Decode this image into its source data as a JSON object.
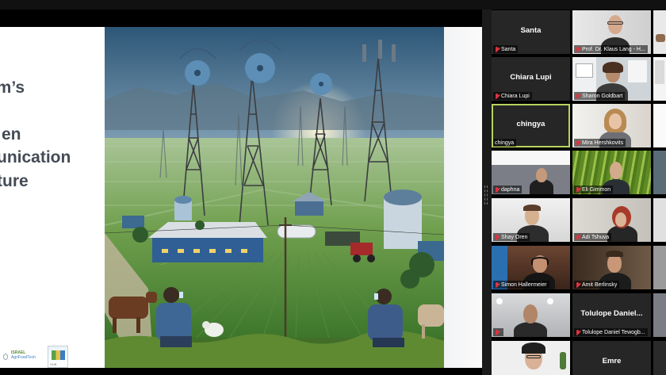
{
  "slide": {
    "title_lines": [
      "am’s",
      "en",
      "unication",
      "ture"
    ],
    "logo_text_1": "ISRAEL",
    "logo_text_2": "AgriFoodTech",
    "logo_text_3": "HUB"
  },
  "participants": [
    {
      "name": "Santa",
      "display": "Santa",
      "video": false
    },
    {
      "name": "Prof. Dr. Klaus Lang - H...",
      "display": "",
      "video": true
    },
    {
      "name": "Chiara Lupi",
      "display": "Chiara Lupi",
      "video": false
    },
    {
      "name": "Sharon Goldbart",
      "display": "",
      "video": true
    },
    {
      "name": "chingya",
      "display": "chingya",
      "video": false,
      "active": true
    },
    {
      "name": "Mira Hershkovits",
      "display": "",
      "video": true
    },
    {
      "name": "daphna",
      "display": "",
      "video": true
    },
    {
      "name": "Eli Gimmon",
      "display": "",
      "video": true
    },
    {
      "name": "Shay Oren",
      "display": "",
      "video": true
    },
    {
      "name": "Adi Tshuva",
      "display": "",
      "video": true
    },
    {
      "name": "Simon Hallermeier",
      "display": "",
      "video": true
    },
    {
      "name": "Amit Berlinsky",
      "display": "",
      "video": true
    },
    {
      "name": "",
      "display": "",
      "video": true
    },
    {
      "name": "Tolulope Daniel Tewogb...",
      "display": "Tolulope  Daniel...",
      "video": false
    },
    {
      "name": "",
      "display": "",
      "video": true
    },
    {
      "name": "",
      "display": "Emre",
      "video": false
    }
  ],
  "colors": {
    "active_outline": "#b9d35d",
    "mic_muted": "#e0333f",
    "tile_bg": "#262626",
    "title_text": "#444b55"
  },
  "icons": {
    "muted_mic": "mic-off-icon"
  }
}
